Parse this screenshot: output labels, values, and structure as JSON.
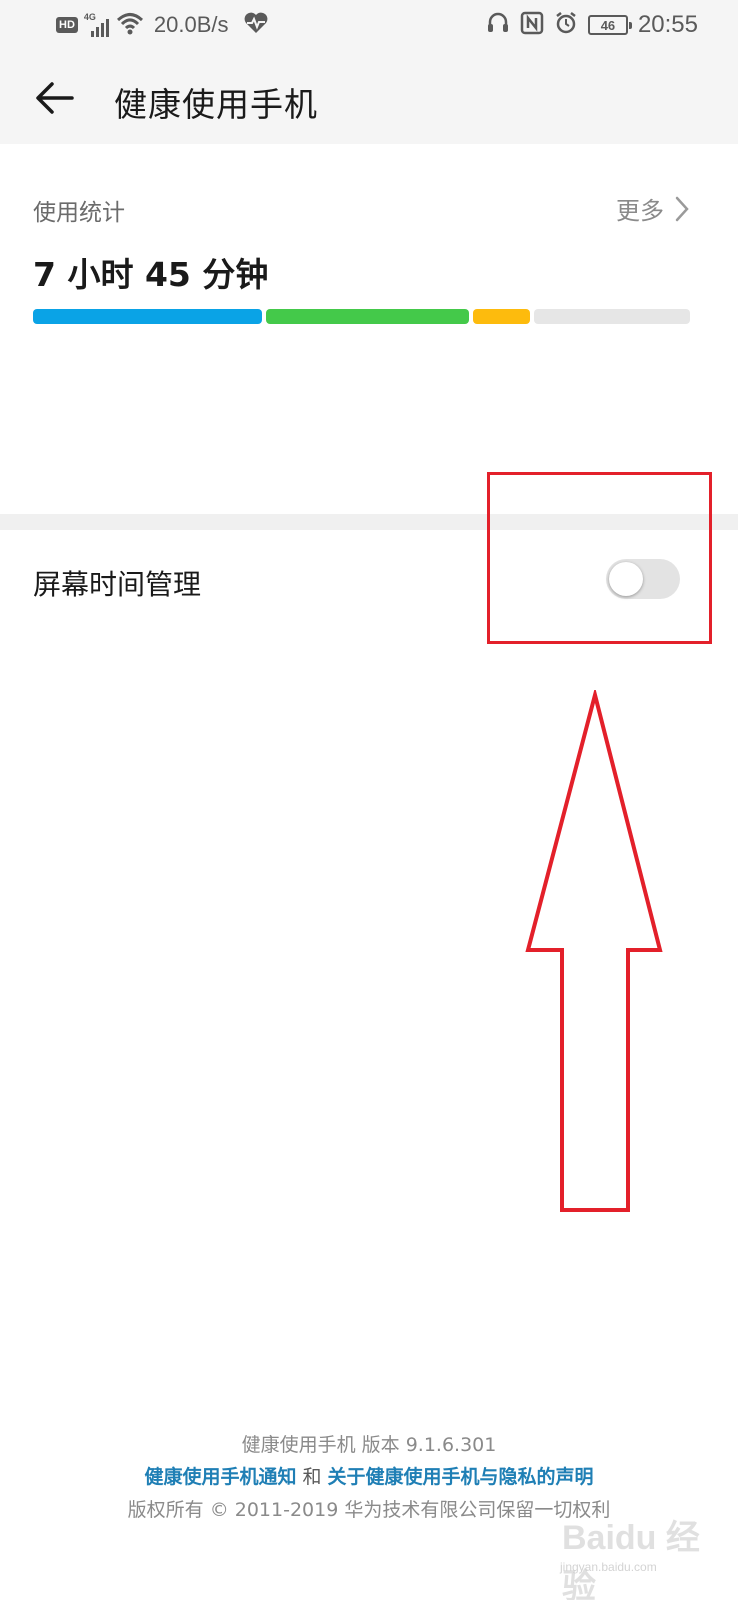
{
  "status_bar": {
    "hd_label": "HD",
    "network_label": "4G",
    "speed": "20.0B/s",
    "battery": "46",
    "time": "20:55",
    "icons": [
      "hd-icon",
      "signal-icon",
      "wifi-icon",
      "heartbeat-icon",
      "headset-icon",
      "nfc-icon",
      "alarm-icon",
      "battery-icon"
    ]
  },
  "app_bar": {
    "back_icon": "back-arrow-icon",
    "title": "健康使用手机"
  },
  "usage": {
    "label": "使用统计",
    "more_label": "更多",
    "more_icon": "chevron-right-icon",
    "total": "7 小时 45 分钟",
    "segments": [
      {
        "color": "#0aa3e6",
        "fraction": 0.355
      },
      {
        "color": "#44c94a",
        "fraction": 0.315
      },
      {
        "color": "#fdbb0d",
        "fraction": 0.088
      },
      {
        "color": "#e6e6e6",
        "fraction": 0.242
      }
    ]
  },
  "screen_time": {
    "label": "屏幕时间管理",
    "enabled": false
  },
  "footer": {
    "version_line": "健康使用手机  版本  9.1.6.301",
    "notice_link": "健康使用手机通知",
    "and_text": " 和 ",
    "privacy_link": "关于健康使用手机与隐私的声明",
    "copyright": "版权所有 © 2011-2019 华为技术有限公司保留一切权利"
  },
  "watermark": {
    "brand": "Baidu 经验",
    "sub": "jingyan.baidu.com"
  },
  "colors": {
    "annotation_red": "#e3202a",
    "link_blue": "#1f7fb5"
  }
}
